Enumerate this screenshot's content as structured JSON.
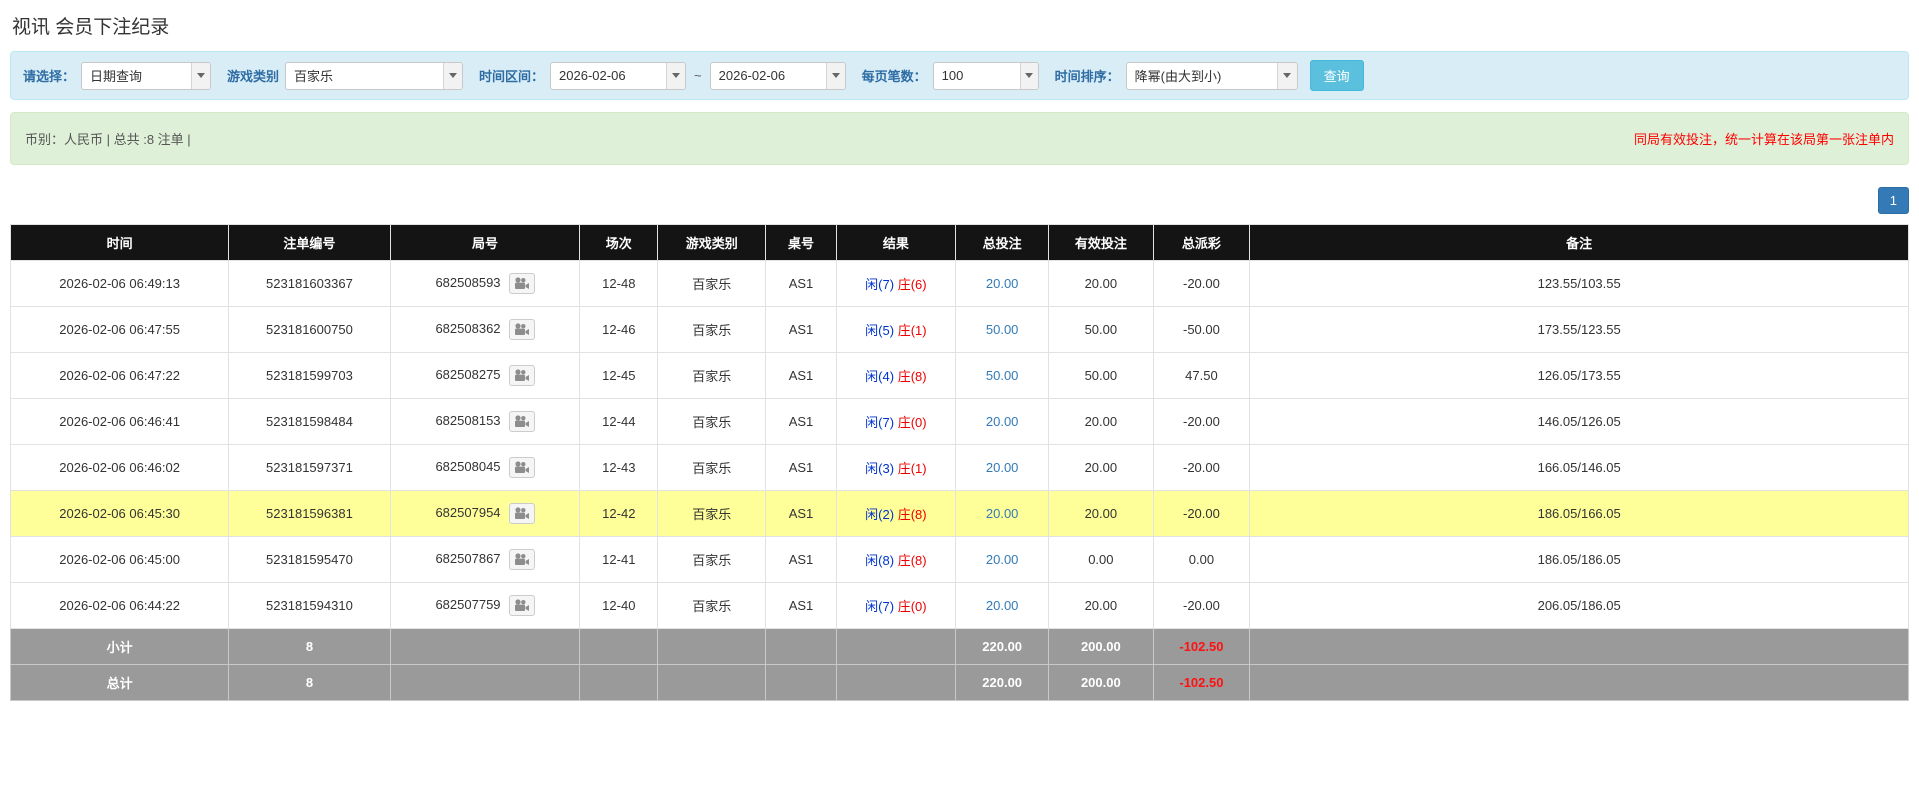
{
  "page": {
    "title": "视讯 会员下注纪录"
  },
  "filters": {
    "select_label": "请选择：",
    "select_value": "日期查询",
    "game_type_label": "游戏类别",
    "game_type_value": "百家乐",
    "time_range_label": "时间区间：",
    "date_from": "2026-02-06",
    "tilde": "~",
    "date_to": "2026-02-06",
    "page_size_label": "每页笔数：",
    "page_size_value": "100",
    "sort_label": "时间排序：",
    "sort_value": "降幂(由大到小)",
    "search_button": "查询"
  },
  "summary": {
    "left": "币别：人民币 | 总共 :8 注单 |",
    "right": "同局有效投注，统一计算在该局第一张注单内"
  },
  "pagination": {
    "page": "1"
  },
  "table": {
    "headers": [
      "时间",
      "注单编号",
      "局号",
      "场次",
      "游戏类别",
      "桌号",
      "结果",
      "总投注",
      "有效投注",
      "总派彩",
      "备注"
    ],
    "rows": [
      {
        "time": "2026-02-06 06:49:13",
        "bet_id": "523181603367",
        "round": "682508593",
        "session": "12-48",
        "game": "百家乐",
        "table_no": "AS1",
        "result_player": "闲(7)",
        "result_banker": "庄(6)",
        "total_bet": "20.00",
        "valid_bet": "20.00",
        "payout": "-20.00",
        "note": "123.55/103.55",
        "highlight": false
      },
      {
        "time": "2026-02-06 06:47:55",
        "bet_id": "523181600750",
        "round": "682508362",
        "session": "12-46",
        "game": "百家乐",
        "table_no": "AS1",
        "result_player": "闲(5)",
        "result_banker": "庄(1)",
        "total_bet": "50.00",
        "valid_bet": "50.00",
        "payout": "-50.00",
        "note": "173.55/123.55",
        "highlight": false
      },
      {
        "time": "2026-02-06 06:47:22",
        "bet_id": "523181599703",
        "round": "682508275",
        "session": "12-45",
        "game": "百家乐",
        "table_no": "AS1",
        "result_player": "闲(4)",
        "result_banker": "庄(8)",
        "total_bet": "50.00",
        "valid_bet": "50.00",
        "payout": "47.50",
        "note": "126.05/173.55",
        "highlight": false
      },
      {
        "time": "2026-02-06 06:46:41",
        "bet_id": "523181598484",
        "round": "682508153",
        "session": "12-44",
        "game": "百家乐",
        "table_no": "AS1",
        "result_player": "闲(7)",
        "result_banker": "庄(0)",
        "total_bet": "20.00",
        "valid_bet": "20.00",
        "payout": "-20.00",
        "note": "146.05/126.05",
        "highlight": false
      },
      {
        "time": "2026-02-06 06:46:02",
        "bet_id": "523181597371",
        "round": "682508045",
        "session": "12-43",
        "game": "百家乐",
        "table_no": "AS1",
        "result_player": "闲(3)",
        "result_banker": "庄(1)",
        "total_bet": "20.00",
        "valid_bet": "20.00",
        "payout": "-20.00",
        "note": "166.05/146.05",
        "highlight": false
      },
      {
        "time": "2026-02-06 06:45:30",
        "bet_id": "523181596381",
        "round": "682507954",
        "session": "12-42",
        "game": "百家乐",
        "table_no": "AS1",
        "result_player": "闲(2)",
        "result_banker": "庄(8)",
        "total_bet": "20.00",
        "valid_bet": "20.00",
        "payout": "-20.00",
        "note": "186.05/166.05",
        "highlight": true
      },
      {
        "time": "2026-02-06 06:45:00",
        "bet_id": "523181595470",
        "round": "682507867",
        "session": "12-41",
        "game": "百家乐",
        "table_no": "AS1",
        "result_player": "闲(8)",
        "result_banker": "庄(8)",
        "total_bet": "20.00",
        "valid_bet": "0.00",
        "payout": "0.00",
        "note": "186.05/186.05",
        "highlight": false
      },
      {
        "time": "2026-02-06 06:44:22",
        "bet_id": "523181594310",
        "round": "682507759",
        "session": "12-40",
        "game": "百家乐",
        "table_no": "AS1",
        "result_player": "闲(7)",
        "result_banker": "庄(0)",
        "total_bet": "20.00",
        "valid_bet": "20.00",
        "payout": "-20.00",
        "note": "206.05/186.05",
        "highlight": false
      }
    ],
    "subtotal": {
      "label": "小计",
      "count": "8",
      "total_bet": "220.00",
      "valid_bet": "200.00",
      "payout": "-102.50"
    },
    "total": {
      "label": "总计",
      "count": "8",
      "total_bet": "220.00",
      "valid_bet": "200.00",
      "payout": "-102.50"
    }
  },
  "colors": {
    "accent_blue": "#337ab7",
    "info_button": "#5bc0de",
    "player_blue": "#0033cc",
    "banker_red": "#ee0000",
    "negative_red": "#ff0000",
    "highlight_yellow": "#ffff99",
    "header_black": "#141414"
  }
}
